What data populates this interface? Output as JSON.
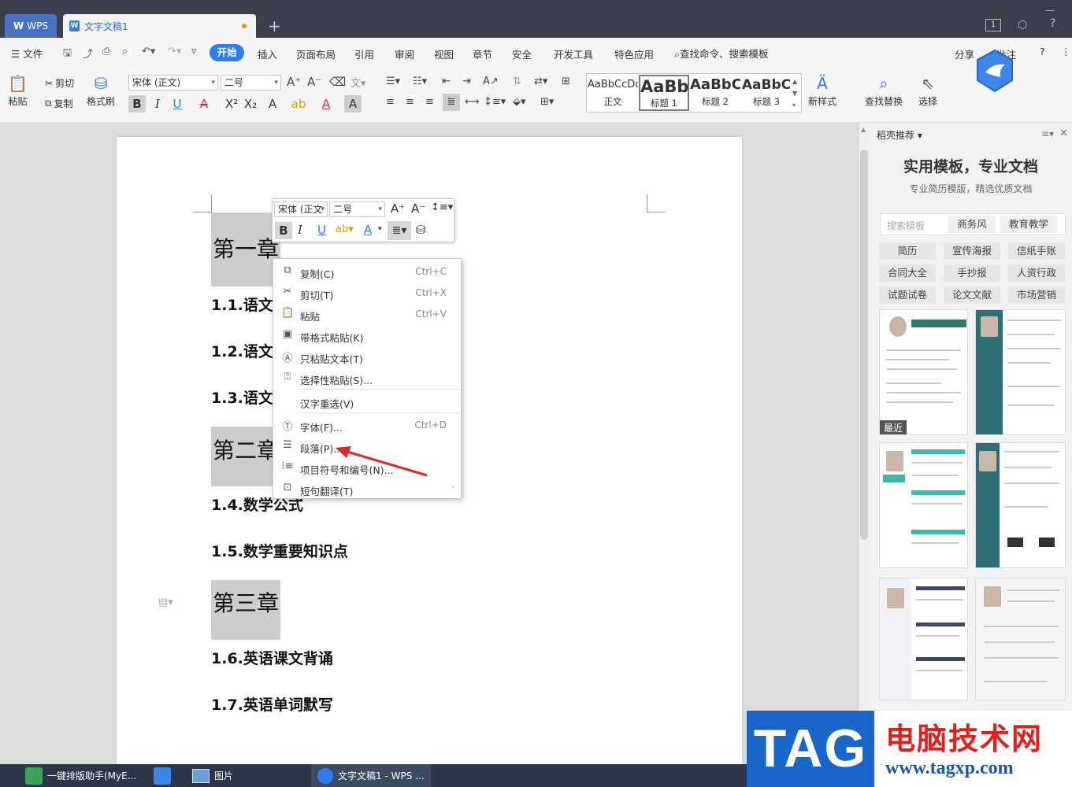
{
  "titlebar": {
    "app_tab": "WPS",
    "doc_tab": "文字文稿1",
    "badge": "1"
  },
  "menu": {
    "file": "文件",
    "items": [
      "开始",
      "插入",
      "页面布局",
      "引用",
      "审阅",
      "视图",
      "章节",
      "安全",
      "开发工具",
      "特色应用"
    ],
    "search": "查找命令、搜索模板",
    "share": "分享",
    "comment": "批注"
  },
  "ribbon": {
    "paste": "粘贴",
    "cut": "剪切",
    "copy": "复制",
    "format_painter": "格式刷",
    "font_name": "宋体 (正文)",
    "font_size": "二号",
    "styles": [
      {
        "sample": "AaBbCcDd",
        "name": "正文"
      },
      {
        "sample": "AaBb",
        "name": "标题 1"
      },
      {
        "sample": "AaBbC",
        "name": "标题 2"
      },
      {
        "sample": "AaBbC",
        "name": "标题 3"
      }
    ],
    "new_style": "新样式",
    "find_replace": "查找替换",
    "select": "选择"
  },
  "document": {
    "ch1": "第一章",
    "s11": "1.1.语文",
    "s12": "1.2.语文",
    "s13": "1.3.语文",
    "ch2": "第二章",
    "s14": "1.4.数学公式",
    "s15": "1.5.数学重要知识点",
    "ch3": "第三章",
    "s16": "1.6.英语课文背诵",
    "s17": "1.7.英语单词默写"
  },
  "mini_toolbar": {
    "font": "宋体 (正文",
    "size": "二号"
  },
  "context_menu": [
    {
      "label": "复制(C)",
      "shortcut": "Ctrl+C",
      "icon": "copy-icon"
    },
    {
      "label": "剪切(T)",
      "shortcut": "Ctrl+X",
      "icon": "cut-icon"
    },
    {
      "label": "粘贴",
      "shortcut": "Ctrl+V",
      "icon": "paste-icon"
    },
    {
      "label": "带格式粘贴(K)",
      "shortcut": "",
      "icon": "paste-format-icon"
    },
    {
      "label": "只粘贴文本(T)",
      "shortcut": "",
      "icon": "paste-text-icon"
    },
    {
      "label": "选择性粘贴(S)...",
      "shortcut": "",
      "icon": "paste-special-icon"
    },
    {
      "label": "汉字重选(V)",
      "shortcut": "",
      "icon": ""
    },
    {
      "label": "字体(F)...",
      "shortcut": "Ctrl+D",
      "icon": "font-icon"
    },
    {
      "label": "段落(P)...",
      "shortcut": "",
      "icon": "paragraph-icon"
    },
    {
      "label": "项目符号和编号(N)...",
      "shortcut": "",
      "icon": "bullets-icon"
    },
    {
      "label": "短句翻译(T)",
      "shortcut": "",
      "icon": "translate-icon"
    }
  ],
  "sidebar": {
    "header": "稻壳推荐",
    "title": "实用模板，专业文档",
    "subtitle": "专业简历模版，精选优质文档",
    "search_placeholder": "搜索模板",
    "search_tags": [
      "商务风",
      "教育教学"
    ],
    "tags": [
      "简历",
      "宣传海报",
      "信纸手账",
      "合同大全",
      "手抄报",
      "人资行政",
      "试题试卷",
      "论文文献",
      "市场营销"
    ],
    "recent_badge": "最近"
  },
  "taskbar": {
    "items": [
      "一键排版助手(MyE...",
      "图片",
      "文字文稿1 - WPS ..."
    ]
  },
  "watermark": {
    "logo": "TAG",
    "cn": "电脑技术网",
    "url": "www.tagxp.com"
  },
  "colors": {
    "accent": "#2d7cf3",
    "titlebar": "#3a3f4b",
    "heading_highlight": "#cdcdcd",
    "arrow": "#d42a2a"
  }
}
